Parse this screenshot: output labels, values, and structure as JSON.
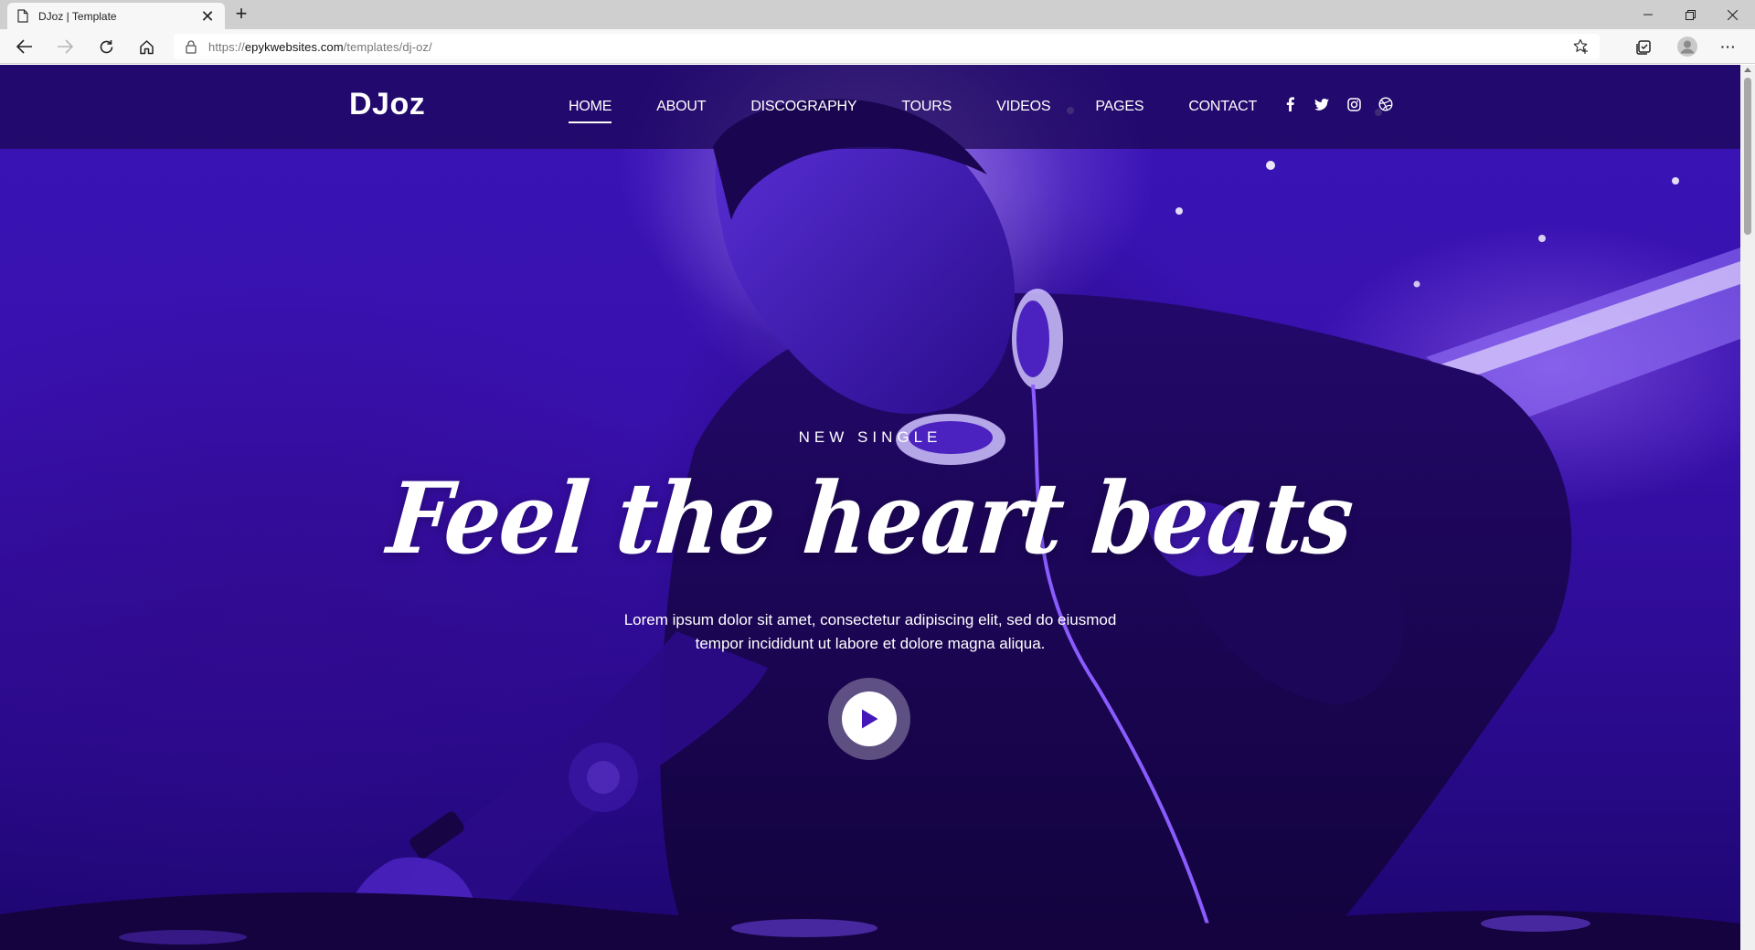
{
  "browser": {
    "tab_title": "DJoz | Template",
    "tab_close": "✕",
    "new_tab": "+",
    "url_scheme": "https://",
    "url_host": "epykwebsites.com",
    "url_path": "/templates/dj-oz/",
    "window_controls": {
      "minimize": "—",
      "restore": "❐",
      "close": "✕"
    },
    "menu_label": "···"
  },
  "site": {
    "logo": "DJoz",
    "nav": [
      {
        "label": "HOME",
        "active": true
      },
      {
        "label": "ABOUT"
      },
      {
        "label": "DISCOGRAPHY"
      },
      {
        "label": "TOURS"
      },
      {
        "label": "VIDEOS"
      },
      {
        "label": "PAGES"
      },
      {
        "label": "CONTACT"
      }
    ],
    "social_icons": [
      "facebook-icon",
      "twitter-icon",
      "instagram-icon",
      "dribbble-icon"
    ]
  },
  "hero": {
    "eyebrow": "NEW SINGLE",
    "headline": "Feel the heart beats",
    "lead_line1": "Lorem ipsum dolor sit amet, consectetur adipiscing elit, sed do eiusmod",
    "lead_line2": "tempor incididunt ut labore et dolore magna aliqua.",
    "play_icon": "play-icon"
  },
  "colors": {
    "hero_purple": "#3a14b8",
    "hero_dark": "#1c0670",
    "play_triangle": "#4418b8"
  }
}
